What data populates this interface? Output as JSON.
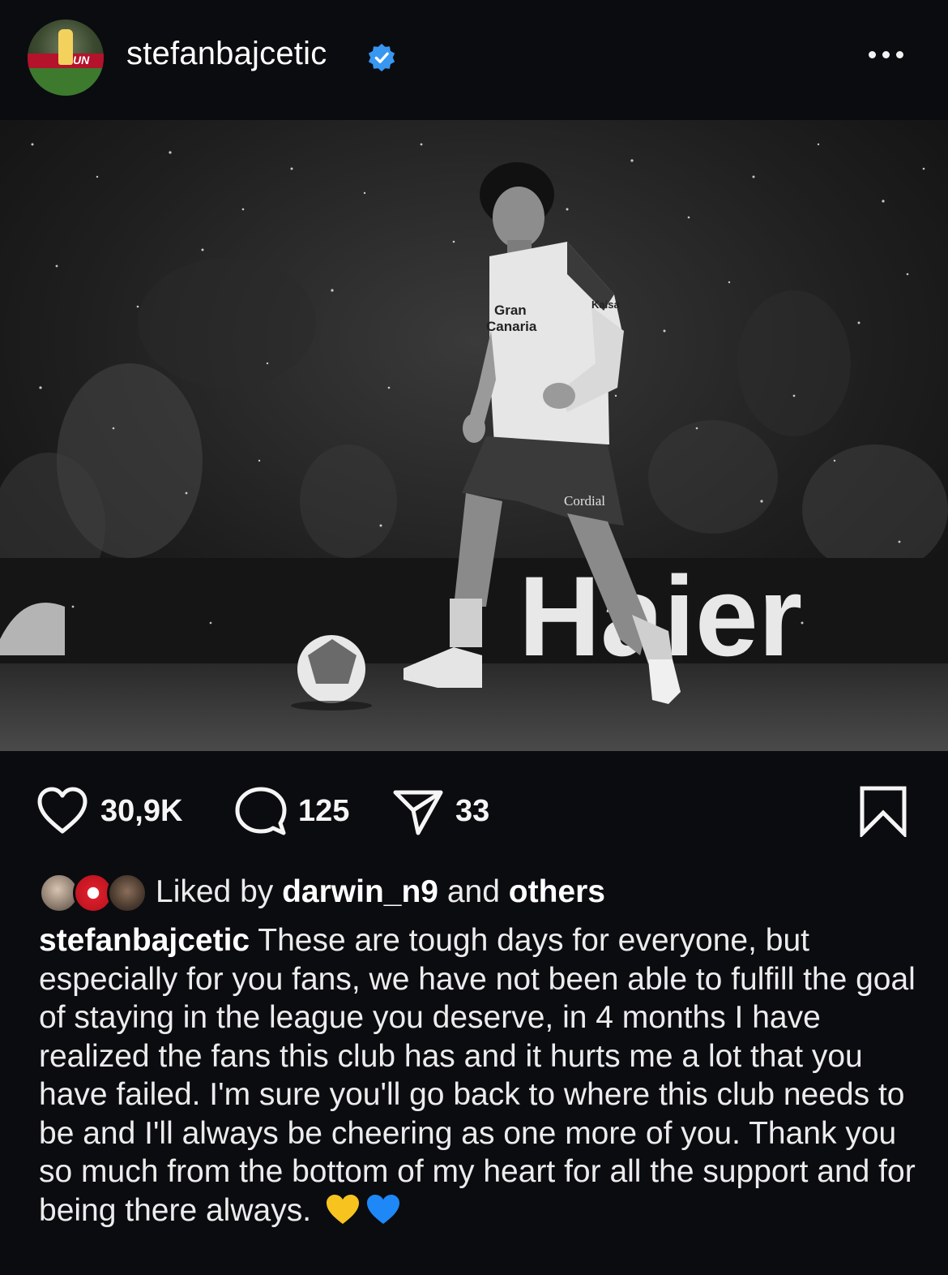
{
  "post": {
    "username": "stefanbajcetic",
    "avatar_band_text": "UN",
    "image_text": {
      "shirt_sponsor_1": "Gran",
      "shirt_sponsor_2": "Canaria",
      "shorts_sponsor": "Cordial",
      "sleeve_text": "Kaisa",
      "board_text": "Haier"
    },
    "likes": "30,9K",
    "comments": "125",
    "shares": "33",
    "liked_by_prefix": "Liked by",
    "liked_by_user": "darwin_n9",
    "liked_by_middle": "and",
    "liked_by_others": "others",
    "caption": "These are tough days for everyone, but especially for you fans, we have not been able to fulfill the goal of staying in the league you deserve, in 4 months I have realized the fans this club has and it hurts me a lot that you have failed. I'm sure you'll go back to where this club needs to be and I'll always be cheering as one more of you. Thank you so much from the bottom of my heart for all the support and for being there always."
  },
  "icons": {
    "verified": "verified-badge-icon",
    "more": "more-options-icon",
    "like": "heart-outline-icon",
    "comment": "comment-bubble-icon",
    "share": "paper-plane-icon",
    "save": "bookmark-outline-icon",
    "emoji_1": "yellow-heart-icon",
    "emoji_2": "blue-heart-icon"
  },
  "colors": {
    "background": "#0b0c10",
    "verified": "#3897f0",
    "yellow_heart": "#f7c31f",
    "blue_heart": "#1e88f7"
  }
}
